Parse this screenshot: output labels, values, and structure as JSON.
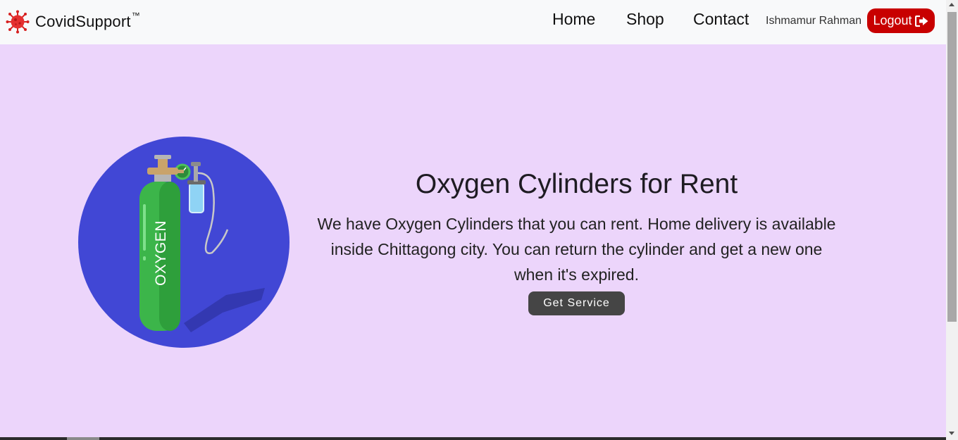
{
  "navbar": {
    "brand_name": "CovidSupport",
    "brand_mark": "™",
    "links": [
      {
        "label": "Home"
      },
      {
        "label": "Shop"
      },
      {
        "label": "Contact"
      }
    ],
    "username": "Ishmamur Rahman",
    "logout_label": "Logout"
  },
  "hero": {
    "image_label": "OXYGEN",
    "title": "Oxygen Cylinders for Rent",
    "description": "We have Oxygen Cylinders that you can rent. Home delivery is available inside Chittagong city. You can return the cylinder and get a new one when it's expired.",
    "cta_label": "Get Service"
  },
  "colors": {
    "page_background": "#ecd5fb",
    "navbar_background": "#f8f9fa",
    "logout_button": "#c80000",
    "cta_button": "#454545",
    "image_circle": "#4147d5",
    "cylinder": "#3cb54a"
  },
  "icons": {
    "brand": "virus-icon",
    "logout": "sign-out-icon"
  }
}
